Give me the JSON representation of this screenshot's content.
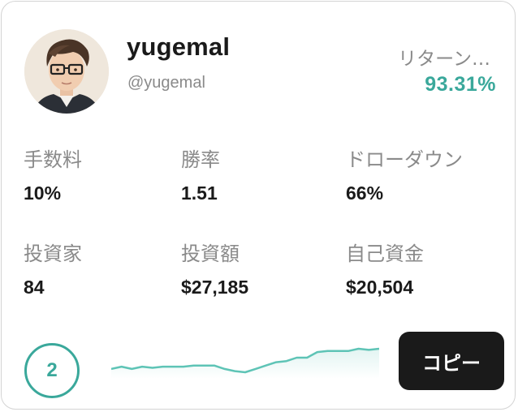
{
  "trader": {
    "name": "yugemal",
    "handle": "@yugemal",
    "avatar_icon": "avatar-icon"
  },
  "return": {
    "label": "リターン…",
    "value": "93.31%",
    "color": "#3aa89b"
  },
  "stats": [
    {
      "label": "手数料",
      "value": "10%"
    },
    {
      "label": "勝率",
      "value": "1.51"
    },
    {
      "label": "ドローダウン",
      "value": "66%"
    },
    {
      "label": "投資家",
      "value": "84"
    },
    {
      "label": "投資額",
      "value": "$27,185"
    },
    {
      "label": "自己資金",
      "value": "$20,504"
    }
  ],
  "rank": "2",
  "sparkline": {
    "color": "#5ec4b6",
    "values": [
      41,
      43,
      41,
      43,
      42,
      43,
      43,
      43,
      44,
      44,
      44,
      41,
      39,
      38,
      41,
      44,
      47,
      48,
      51,
      51,
      56,
      57,
      57,
      57,
      59,
      58,
      59
    ]
  },
  "copy_button": {
    "label": "コピー"
  }
}
